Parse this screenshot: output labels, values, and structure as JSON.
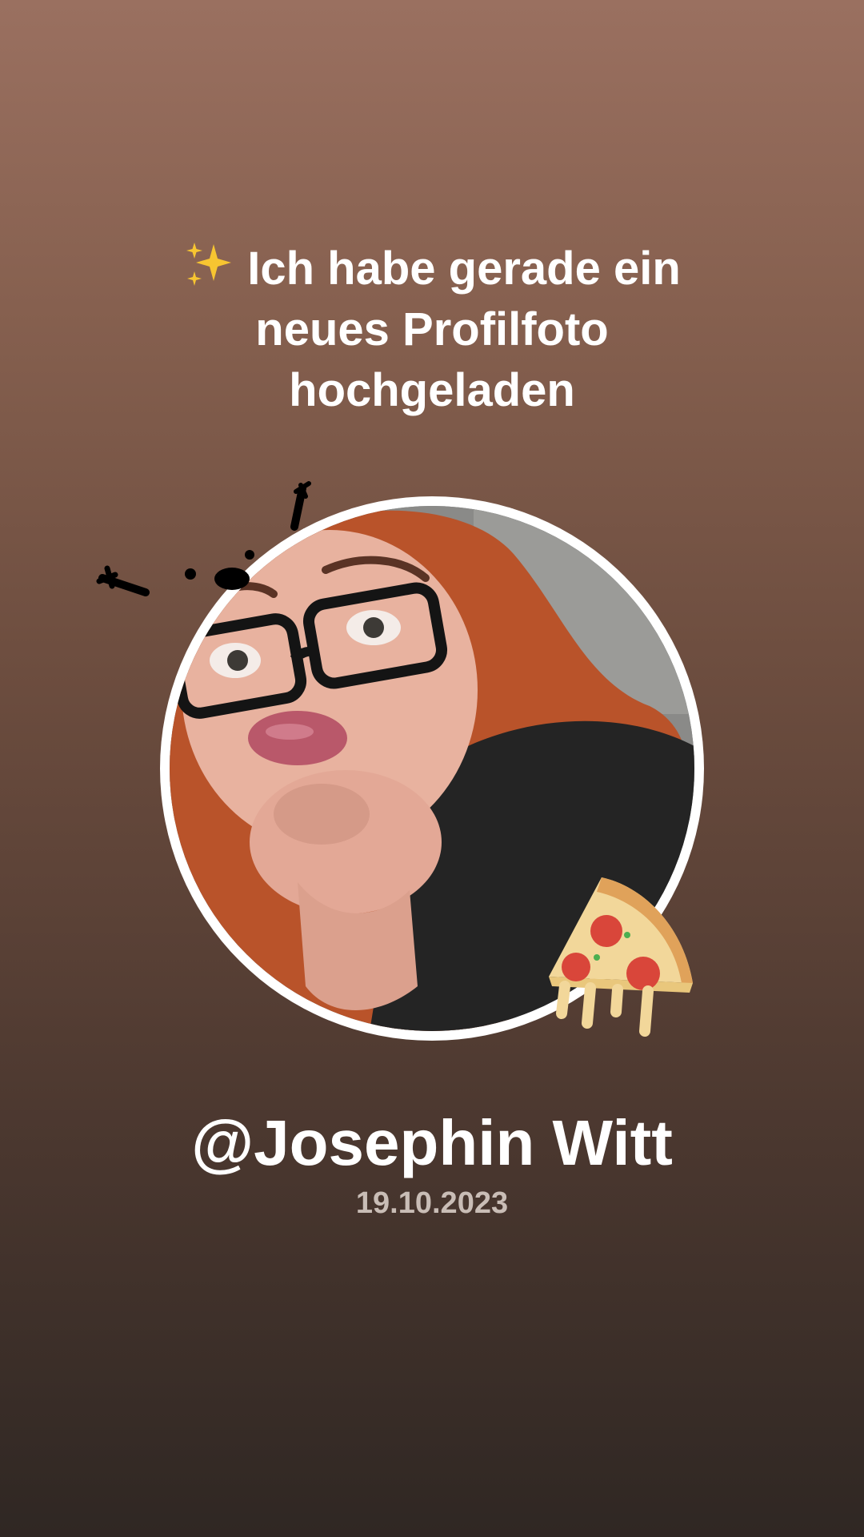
{
  "headline": "Ich habe gerade ein neues Profilfoto hochgeladen",
  "headline_icon": "sparkles-icon",
  "profile": {
    "username": "@Josephin Witt",
    "date": "19.10.2023"
  },
  "stickers": [
    "doodle-sticker",
    "pizza-slice-sticker"
  ],
  "colors": {
    "background_top": "#9a7060",
    "background_bottom": "#2f2723",
    "text": "#ffffff",
    "date_text": "#c9bdb6",
    "avatar_ring": "#ffffff"
  }
}
